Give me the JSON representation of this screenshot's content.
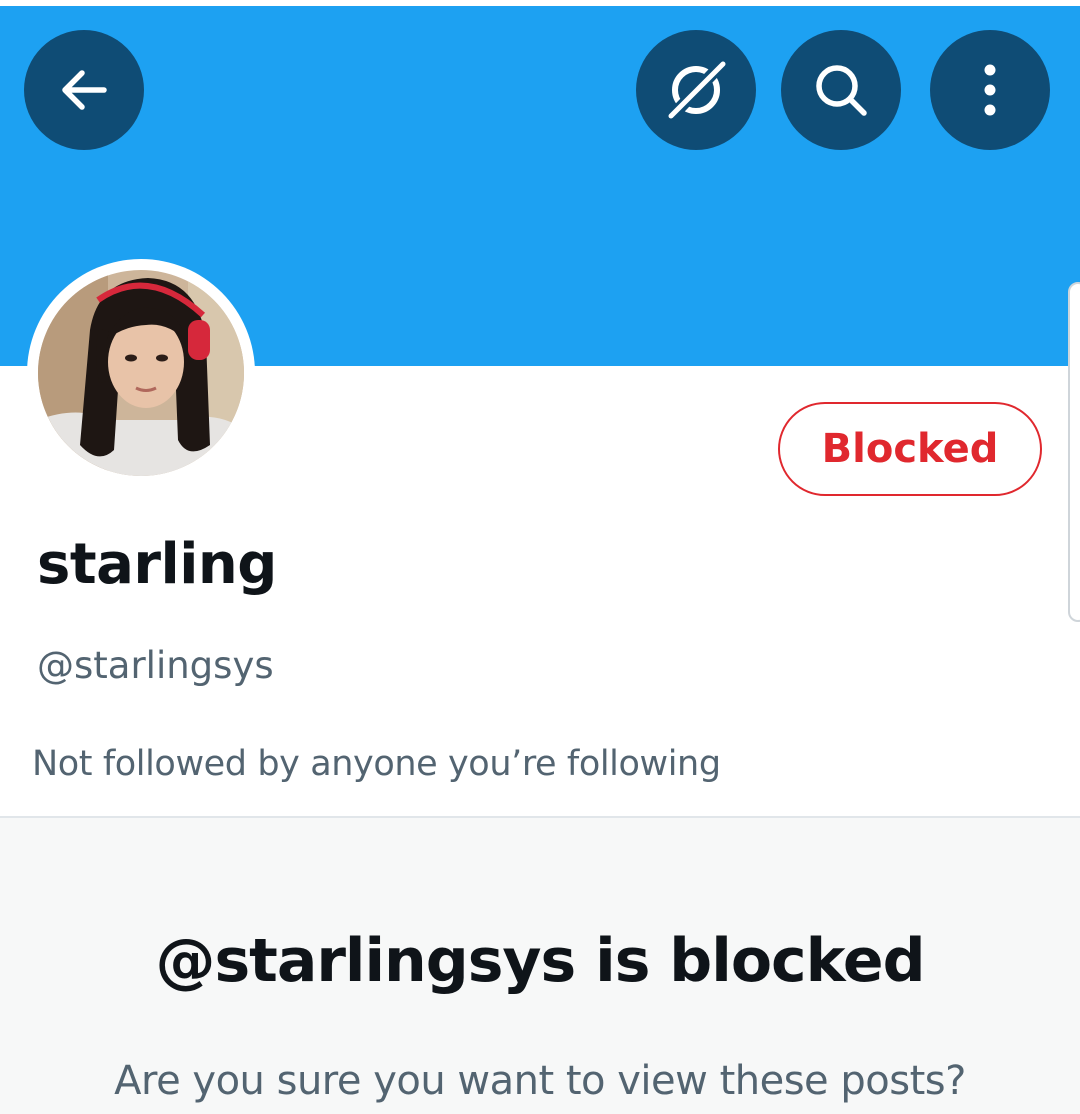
{
  "header": {
    "back_icon": "arrow-left-icon",
    "grok_icon": "grok-slash-circle-icon",
    "search_icon": "search-icon",
    "more_icon": "more-vertical-icon",
    "banner_color": "#1DA1F2",
    "button_color": "#0F4C75"
  },
  "profile": {
    "display_name": "starling",
    "handle": "@starlingsys",
    "follow_context": "Not followed by anyone you’re following",
    "blocked_button_label": "Blocked",
    "blocked_color": "#E0282E"
  },
  "blocked_notice": {
    "title": "@starlingsys is blocked",
    "subtitle": "Are you sure you want to view these posts?"
  }
}
